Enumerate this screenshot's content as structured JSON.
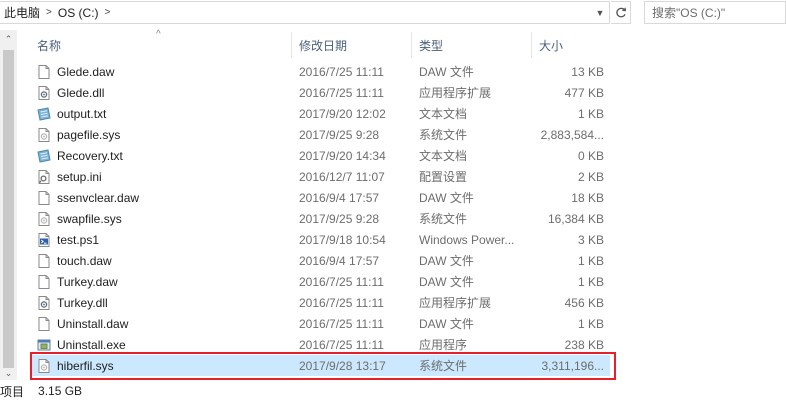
{
  "address": {
    "crumbs": [
      "此电脑",
      "OS (C:)"
    ]
  },
  "search": {
    "placeholder": "搜索\"OS (C:)\""
  },
  "columns": {
    "name": "名称",
    "date": "修改日期",
    "type": "类型",
    "size": "大小"
  },
  "files": [
    {
      "name": "Glede.daw",
      "date": "2016/7/25 11:11",
      "type": "DAW 文件",
      "size": "13 KB",
      "icon": "document-icon"
    },
    {
      "name": "Glede.dll",
      "date": "2016/7/25 11:11",
      "type": "应用程序扩展",
      "size": "477 KB",
      "icon": "dll-gear-icon"
    },
    {
      "name": "output.txt",
      "date": "2017/9/20 12:02",
      "type": "文本文档",
      "size": "1 KB",
      "icon": "text-file-icon"
    },
    {
      "name": "pagefile.sys",
      "date": "2017/9/25 9:28",
      "type": "系统文件",
      "size": "2,883,584...",
      "icon": "system-file-icon"
    },
    {
      "name": "Recovery.txt",
      "date": "2017/9/20 14:34",
      "type": "文本文档",
      "size": "0 KB",
      "icon": "text-file-icon"
    },
    {
      "name": "setup.ini",
      "date": "2016/12/7 11:07",
      "type": "配置设置",
      "size": "2 KB",
      "icon": "settings-file-icon"
    },
    {
      "name": "ssenvclear.daw",
      "date": "2016/9/4 17:57",
      "type": "DAW 文件",
      "size": "18 KB",
      "icon": "document-icon"
    },
    {
      "name": "swapfile.sys",
      "date": "2017/9/25 9:28",
      "type": "系统文件",
      "size": "16,384 KB",
      "icon": "system-file-icon"
    },
    {
      "name": "test.ps1",
      "date": "2017/9/18 10:54",
      "type": "Windows Power...",
      "size": "3 KB",
      "icon": "powershell-icon"
    },
    {
      "name": "touch.daw",
      "date": "2016/9/4 17:57",
      "type": "DAW 文件",
      "size": "1 KB",
      "icon": "document-icon"
    },
    {
      "name": "Turkey.daw",
      "date": "2016/7/25 11:11",
      "type": "DAW 文件",
      "size": "1 KB",
      "icon": "document-icon"
    },
    {
      "name": "Turkey.dll",
      "date": "2016/7/25 11:11",
      "type": "应用程序扩展",
      "size": "456 KB",
      "icon": "dll-gear-icon"
    },
    {
      "name": "Uninstall.daw",
      "date": "2016/7/25 11:11",
      "type": "DAW 文件",
      "size": "1 KB",
      "icon": "document-icon"
    },
    {
      "name": "Uninstall.exe",
      "date": "2016/7/25 11:11",
      "type": "应用程序",
      "size": "238 KB",
      "icon": "exe-installer-icon"
    },
    {
      "name": "hiberfil.sys",
      "date": "2017/9/28 13:17",
      "type": "系统文件",
      "size": "3,311,196...",
      "icon": "system-file-icon",
      "selected": true
    }
  ],
  "status": {
    "count_label": "项目",
    "size": "3.15 GB"
  },
  "colors": {
    "selection": "#cce8ff",
    "highlight_border": "#e81e28",
    "header_text": "#4c607a"
  }
}
